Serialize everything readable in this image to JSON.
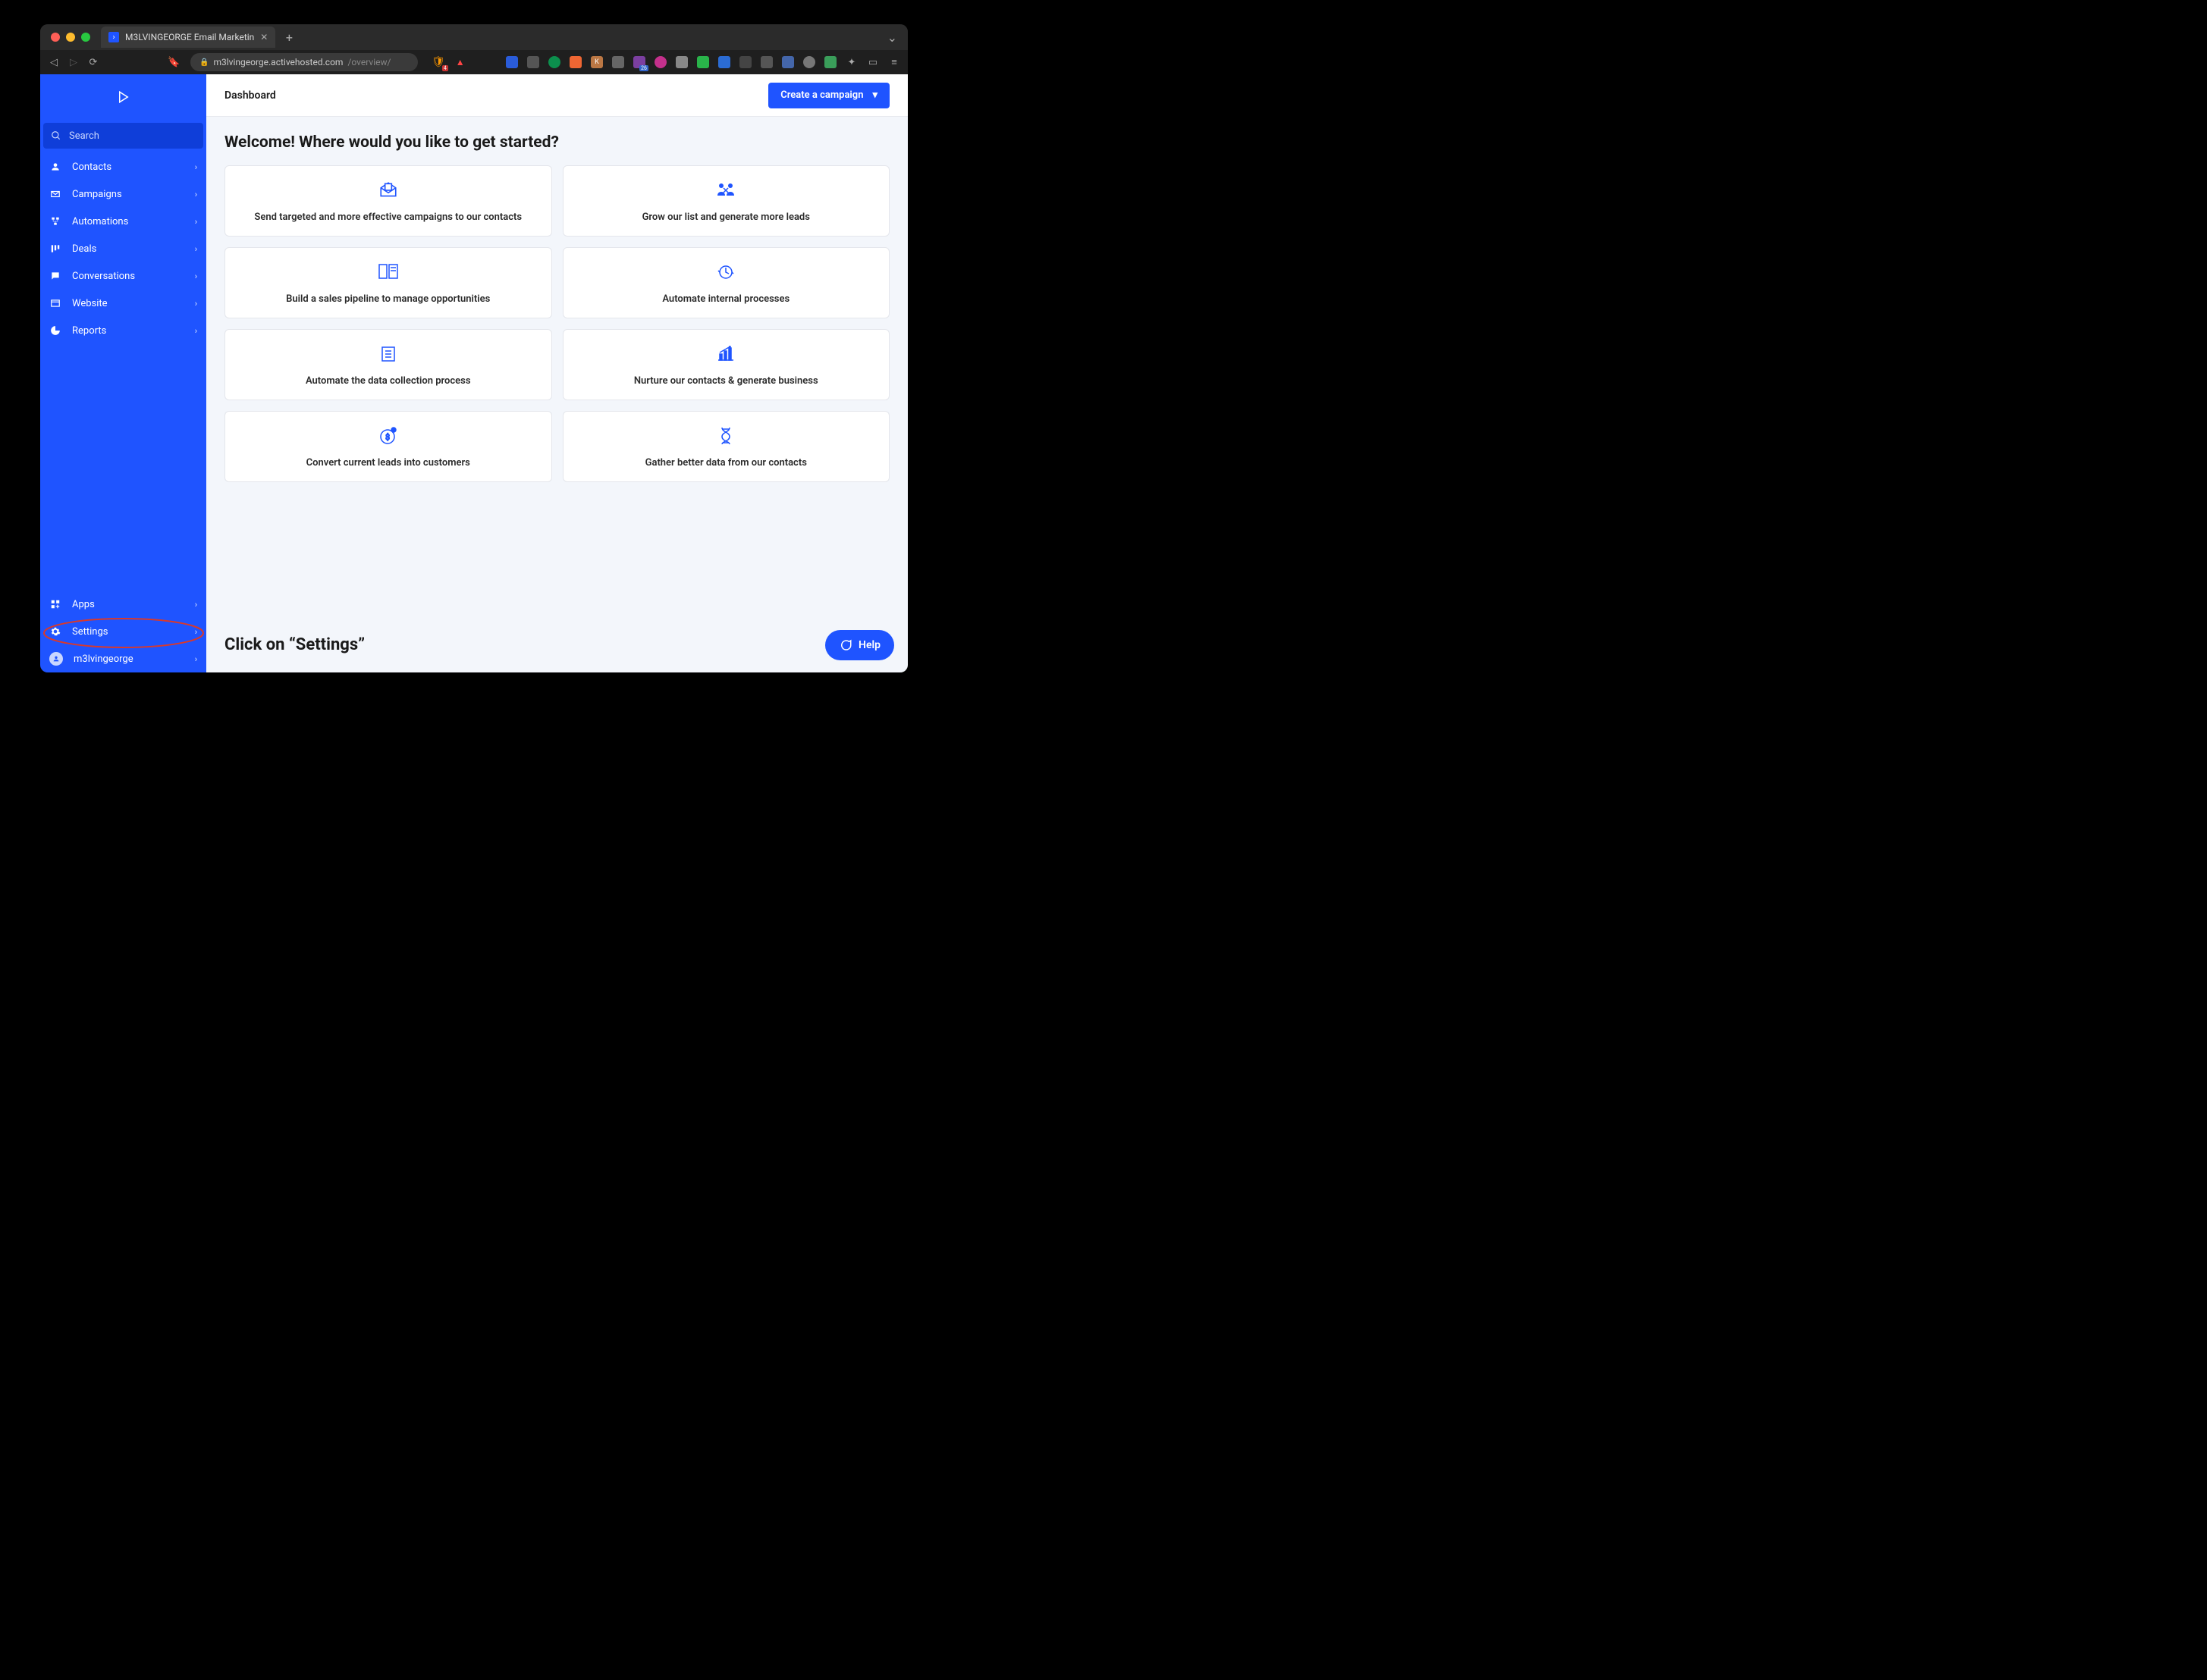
{
  "browser": {
    "tab_title": "M3LVINGEORGE Email Marketin",
    "url_host": "m3lvingeorge.activehosted.com",
    "url_path": "/overview/",
    "shield_badge": "4",
    "ext_badge_26": "26"
  },
  "sidebar": {
    "search_placeholder": "Search",
    "nav": [
      {
        "label": "Contacts"
      },
      {
        "label": "Campaigns"
      },
      {
        "label": "Automations"
      },
      {
        "label": "Deals"
      },
      {
        "label": "Conversations"
      },
      {
        "label": "Website"
      },
      {
        "label": "Reports"
      }
    ],
    "apps_label": "Apps",
    "settings_label": "Settings",
    "username": "m3lvingeorge"
  },
  "header": {
    "page_title": "Dashboard",
    "cta_label": "Create a campaign"
  },
  "welcome_heading": "Welcome! Where would you like to get started?",
  "cards": [
    {
      "label": "Send targeted and more effective campaigns to our contacts"
    },
    {
      "label": "Grow our list and generate more leads"
    },
    {
      "label": "Build a sales pipeline to manage opportunities"
    },
    {
      "label": "Automate internal processes"
    },
    {
      "label": "Automate the data collection process"
    },
    {
      "label": "Nurture our contacts & generate business"
    },
    {
      "label": "Convert current leads into customers"
    },
    {
      "label": "Gather better data from our contacts"
    }
  ],
  "callout": "Click on “Settings”",
  "help_label": "Help"
}
